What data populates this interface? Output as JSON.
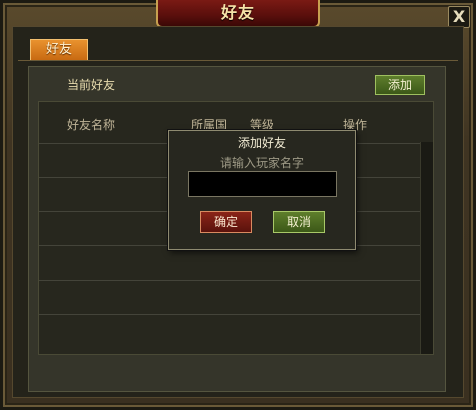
{
  "window": {
    "title": "好友",
    "close_label": "X"
  },
  "tabs": [
    {
      "label": "好友",
      "active": true
    }
  ],
  "panel": {
    "current_label": "当前好友",
    "add_label": "添加"
  },
  "table": {
    "columns": [
      "好友名称",
      "所属国",
      "等级",
      "操作"
    ],
    "rows": []
  },
  "dialog": {
    "title": "添加好友",
    "hint": "请输入玩家名字",
    "input_value": "",
    "confirm_label": "确定",
    "cancel_label": "取消"
  },
  "colors": {
    "title_bg": "#5a0f0c",
    "tab_active": "#d97a1e",
    "add_button": "#4a6a22",
    "confirm_button": "#6e1a12",
    "cancel_button": "#4a6a22"
  }
}
